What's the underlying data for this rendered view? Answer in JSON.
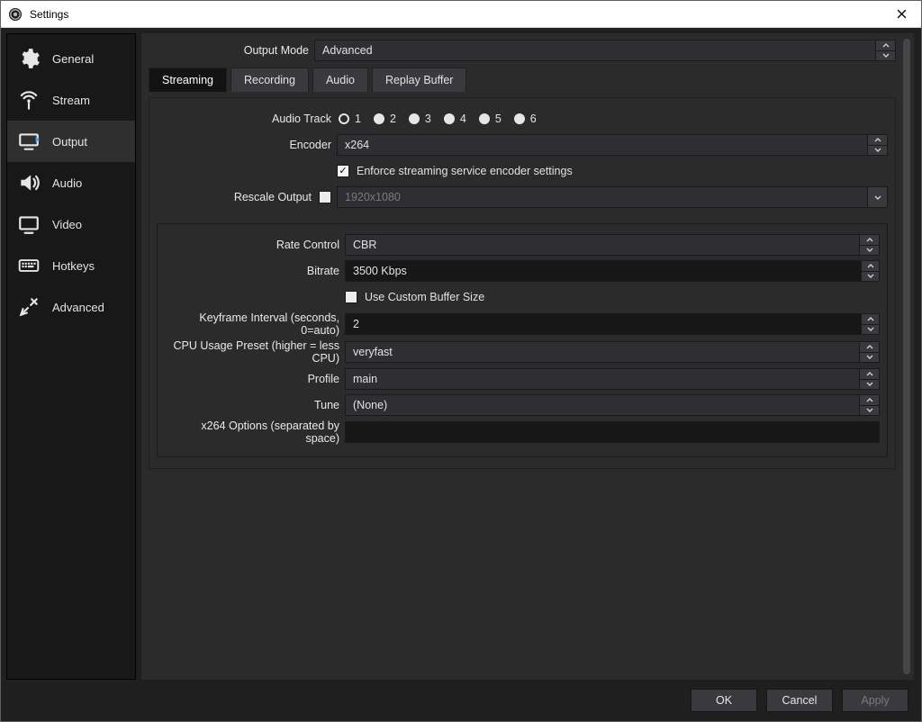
{
  "window": {
    "title": "Settings"
  },
  "sidebar": {
    "items": [
      {
        "id": "general",
        "label": "General"
      },
      {
        "id": "stream",
        "label": "Stream"
      },
      {
        "id": "output",
        "label": "Output"
      },
      {
        "id": "audio",
        "label": "Audio"
      },
      {
        "id": "video",
        "label": "Video"
      },
      {
        "id": "hotkeys",
        "label": "Hotkeys"
      },
      {
        "id": "advanced",
        "label": "Advanced"
      }
    ],
    "active": "output"
  },
  "output": {
    "output_mode_label": "Output Mode",
    "output_mode_value": "Advanced",
    "tabs": {
      "streaming": "Streaming",
      "recording": "Recording",
      "audio": "Audio",
      "replay_buffer": "Replay Buffer"
    },
    "active_tab": "streaming",
    "streaming": {
      "audio_track_label": "Audio Track",
      "audio_track_options": [
        "1",
        "2",
        "3",
        "4",
        "5",
        "6"
      ],
      "audio_track_selected": "1",
      "encoder_label": "Encoder",
      "encoder_value": "x264",
      "enforce_label": "Enforce streaming service encoder settings",
      "enforce_checked": true,
      "rescale_label": "Rescale Output",
      "rescale_checked": false,
      "rescale_value": "1920x1080",
      "encoder_settings": {
        "rate_control_label": "Rate Control",
        "rate_control_value": "CBR",
        "bitrate_label": "Bitrate",
        "bitrate_value": "3500 Kbps",
        "custom_buffer_label": "Use Custom Buffer Size",
        "custom_buffer_checked": false,
        "keyframe_label": "Keyframe Interval (seconds, 0=auto)",
        "keyframe_value": "2",
        "cpu_preset_label": "CPU Usage Preset (higher = less CPU)",
        "cpu_preset_value": "veryfast",
        "profile_label": "Profile",
        "profile_value": "main",
        "tune_label": "Tune",
        "tune_value": "(None)",
        "x264_options_label": "x264 Options (separated by space)",
        "x264_options_value": ""
      }
    }
  },
  "footer": {
    "ok": "OK",
    "cancel": "Cancel",
    "apply": "Apply"
  }
}
